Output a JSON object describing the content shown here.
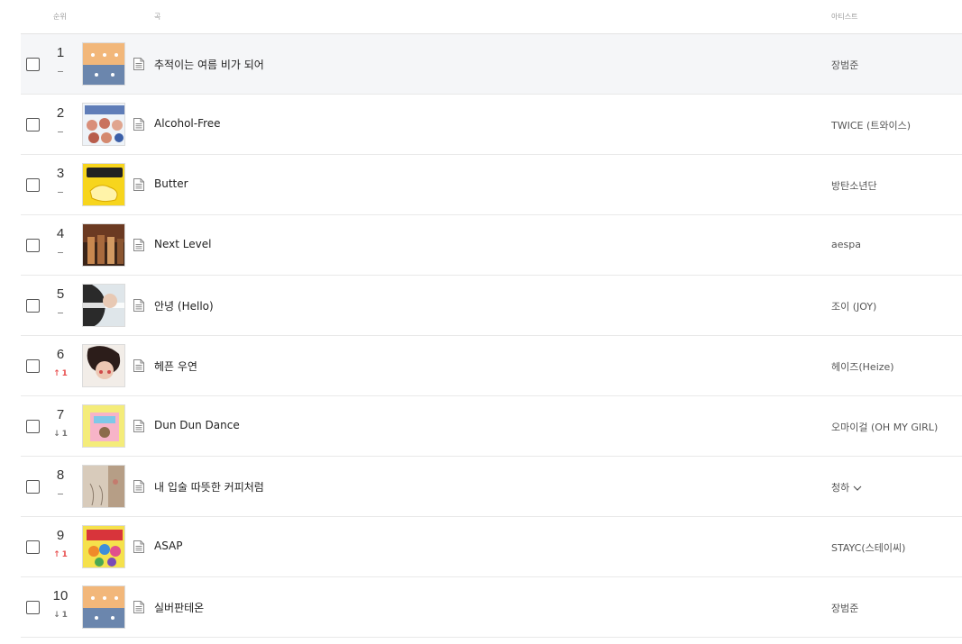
{
  "header": {
    "rank_label": "순위",
    "song_label": "곡",
    "artist_label": "아티스트"
  },
  "colors": {
    "row_highlight": "#f5f6f8",
    "rank_up": "#e85050",
    "rank_down": "#777777"
  },
  "rows": [
    {
      "rank": "1",
      "change": "same",
      "change_value": "",
      "title": "추적이는 여름 비가 되어",
      "artist": "장범준",
      "cover": "rom-sp-cover",
      "highlight": true,
      "artist_more": false
    },
    {
      "rank": "2",
      "change": "same",
      "change_value": "",
      "title": "Alcohol-Free",
      "artist": "TWICE (트와이스)",
      "cover": "taste-of-love-cover",
      "highlight": false,
      "artist_more": false
    },
    {
      "rank": "3",
      "change": "same",
      "change_value": "",
      "title": "Butter",
      "artist": "방탄소년단",
      "cover": "butter-cover",
      "highlight": false,
      "artist_more": false
    },
    {
      "rank": "4",
      "change": "same",
      "change_value": "",
      "title": "Next Level",
      "artist": "aespa",
      "cover": "next-level-cover",
      "highlight": false,
      "artist_more": false
    },
    {
      "rank": "5",
      "change": "same",
      "change_value": "",
      "title": "안녕 (Hello)",
      "artist": "조이 (JOY)",
      "cover": "hello-cover",
      "highlight": false,
      "artist_more": false
    },
    {
      "rank": "6",
      "change": "up",
      "change_value": "1",
      "title": "헤픈 우연",
      "artist": "헤이즈(Heize)",
      "cover": "happen-cover",
      "highlight": false,
      "artist_more": false
    },
    {
      "rank": "7",
      "change": "down",
      "change_value": "1",
      "title": "Dun Dun Dance",
      "artist": "오마이걸 (OH MY GIRL)",
      "cover": "dear-ohmygirl-cover",
      "highlight": false,
      "artist_more": false
    },
    {
      "rank": "8",
      "change": "same",
      "change_value": "",
      "title": "내 입술 따뜻한 커피처럼",
      "artist": "청하",
      "cover": "coffee-cover",
      "highlight": false,
      "artist_more": true
    },
    {
      "rank": "9",
      "change": "up",
      "change_value": "1",
      "title": "ASAP",
      "artist": "STAYC(스테이씨)",
      "cover": "staytape-cover",
      "highlight": false,
      "artist_more": false
    },
    {
      "rank": "10",
      "change": "down",
      "change_value": "1",
      "title": "실버판테온",
      "artist": "장범준",
      "cover": "rom-sp-cover",
      "highlight": false,
      "artist_more": false
    }
  ]
}
